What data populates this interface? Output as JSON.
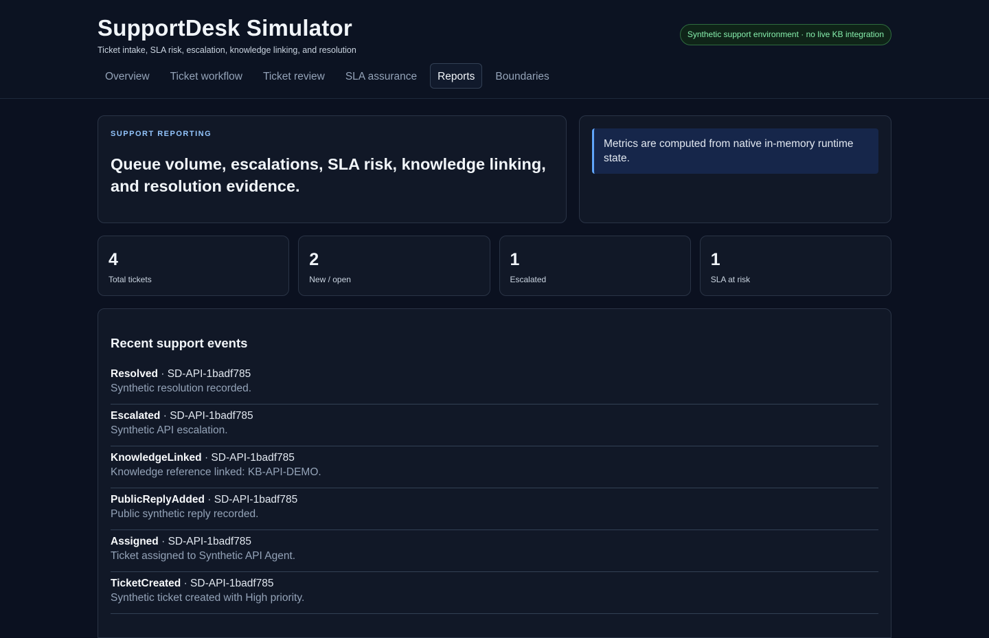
{
  "app": {
    "title": "SupportDesk Simulator",
    "subtitle": "Ticket intake, SLA risk, escalation, knowledge linking, and resolution",
    "badge": "Synthetic support environment · no live KB integration"
  },
  "nav": {
    "tabs": [
      {
        "label": "Overview"
      },
      {
        "label": "Ticket workflow"
      },
      {
        "label": "Ticket review"
      },
      {
        "label": "SLA assurance"
      },
      {
        "label": "Reports"
      },
      {
        "label": "Boundaries"
      }
    ],
    "active": "Reports"
  },
  "hero": {
    "eyebrow": "SUPPORT REPORTING",
    "title": "Queue volume, escalations, SLA risk, knowledge linking, and resolution evidence."
  },
  "note": {
    "text": "Metrics are computed from native in-memory runtime state."
  },
  "stats": [
    {
      "value": "4",
      "label": "Total tickets"
    },
    {
      "value": "2",
      "label": "New / open"
    },
    {
      "value": "1",
      "label": "Escalated"
    },
    {
      "value": "1",
      "label": "SLA at risk"
    }
  ],
  "events": {
    "title": "Recent support events",
    "separator": "·",
    "items": [
      {
        "type": "Resolved",
        "ticket": "SD-API-1badf785",
        "desc": "Synthetic resolution recorded."
      },
      {
        "type": "Escalated",
        "ticket": "SD-API-1badf785",
        "desc": "Synthetic API escalation."
      },
      {
        "type": "KnowledgeLinked",
        "ticket": "SD-API-1badf785",
        "desc": "Knowledge reference linked: KB-API-DEMO."
      },
      {
        "type": "PublicReplyAdded",
        "ticket": "SD-API-1badf785",
        "desc": "Public synthetic reply recorded."
      },
      {
        "type": "Assigned",
        "ticket": "SD-API-1badf785",
        "desc": "Ticket assigned to Synthetic API Agent."
      },
      {
        "type": "TicketCreated",
        "ticket": "SD-API-1badf785",
        "desc": "Synthetic ticket created with High priority."
      }
    ]
  }
}
